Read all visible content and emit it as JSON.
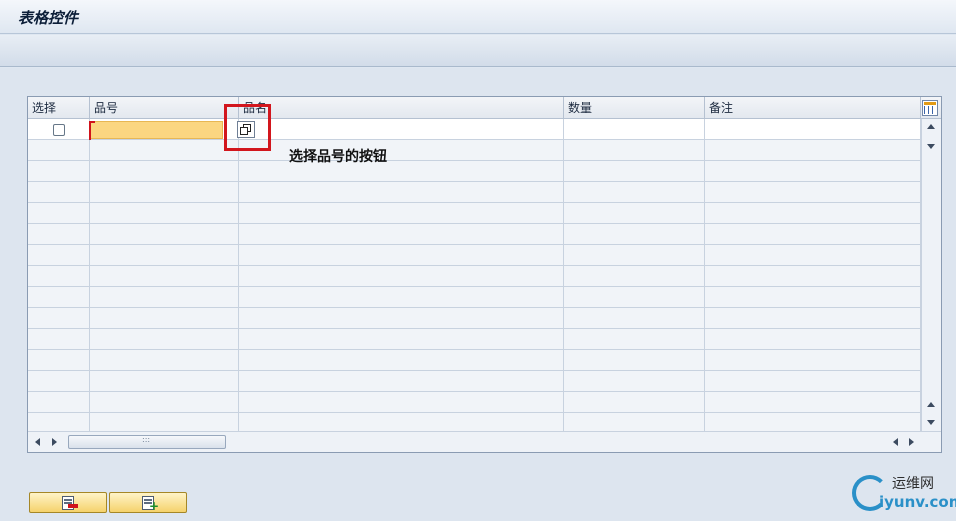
{
  "window": {
    "title": "表格控件"
  },
  "table": {
    "columns": {
      "select": "选择",
      "product_no": "品号",
      "product_name": "品名",
      "quantity": "数量",
      "remark": "备注"
    },
    "first_row": {
      "selected": false,
      "product_no": "",
      "product_name": "",
      "quantity": "",
      "remark": ""
    },
    "visible_row_count": 15
  },
  "annotation": {
    "text": "选择品号的按钮"
  },
  "buttons": {
    "delete_row_icon": "delete-row-icon",
    "insert_row_icon": "insert-row-icon"
  },
  "watermark": {
    "cn": "运维网",
    "en": "iyunv.com"
  },
  "colors": {
    "input_highlight": "#fbd681",
    "annotation_box": "#d2161d",
    "watermark_blue": "#2a90c8"
  }
}
